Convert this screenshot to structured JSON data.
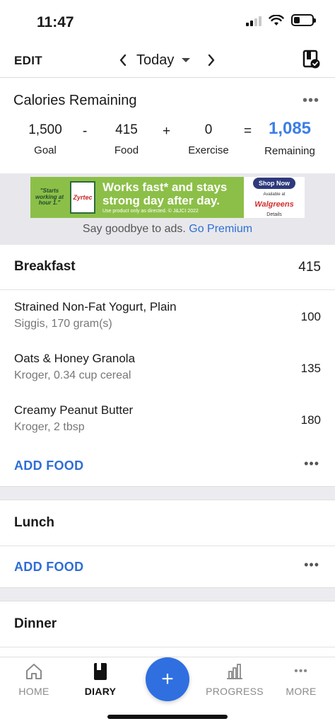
{
  "status_bar": {
    "time": "11:47"
  },
  "header": {
    "edit_label": "EDIT",
    "date_label": "Today"
  },
  "calories": {
    "title": "Calories Remaining",
    "goal_value": "1,500",
    "goal_label": "Goal",
    "op_minus": "-",
    "food_value": "415",
    "food_label": "Food",
    "op_plus": "+",
    "exercise_value": "0",
    "exercise_label": "Exercise",
    "op_equals": "=",
    "remaining_value": "1,085",
    "remaining_label": "Remaining",
    "more": "•••"
  },
  "ad": {
    "left_text": "\"Starts working at hour 1.\"",
    "product": "Zyrtec",
    "headline_1": "Works fast* and stays",
    "headline_2": "strong day after day.",
    "fine_print": "Use product only as directed. © J&JCI 2022",
    "shop_label": "Shop Now",
    "available_at": "Available at",
    "retailer": "Walgreens",
    "details": "Details",
    "premium_text": "Say goodbye to ads.",
    "premium_link": "Go Premium"
  },
  "breakfast": {
    "name": "Breakfast",
    "total": "415",
    "items": [
      {
        "name": "Strained Non-Fat Yogurt, Plain",
        "detail": "Siggis, 170 gram(s)",
        "calories": "100"
      },
      {
        "name": "Oats & Honey Granola",
        "detail": "Kroger, 0.34 cup cereal",
        "calories": "135"
      },
      {
        "name": "Creamy Peanut Butter",
        "detail": "Kroger, 2 tbsp",
        "calories": "180"
      }
    ],
    "add_food": "ADD FOOD",
    "more": "•••"
  },
  "lunch": {
    "name": "Lunch",
    "add_food": "ADD FOOD",
    "more": "•••"
  },
  "dinner": {
    "name": "Dinner"
  },
  "tabs": {
    "home": "HOME",
    "diary": "DIARY",
    "add": "+",
    "progress": "PROGRESS",
    "more": "MORE",
    "more_icon": "•••"
  },
  "colors": {
    "accent": "#2f6fe0",
    "remaining": "#3c7ee6",
    "ad_green": "#8cbf48"
  }
}
